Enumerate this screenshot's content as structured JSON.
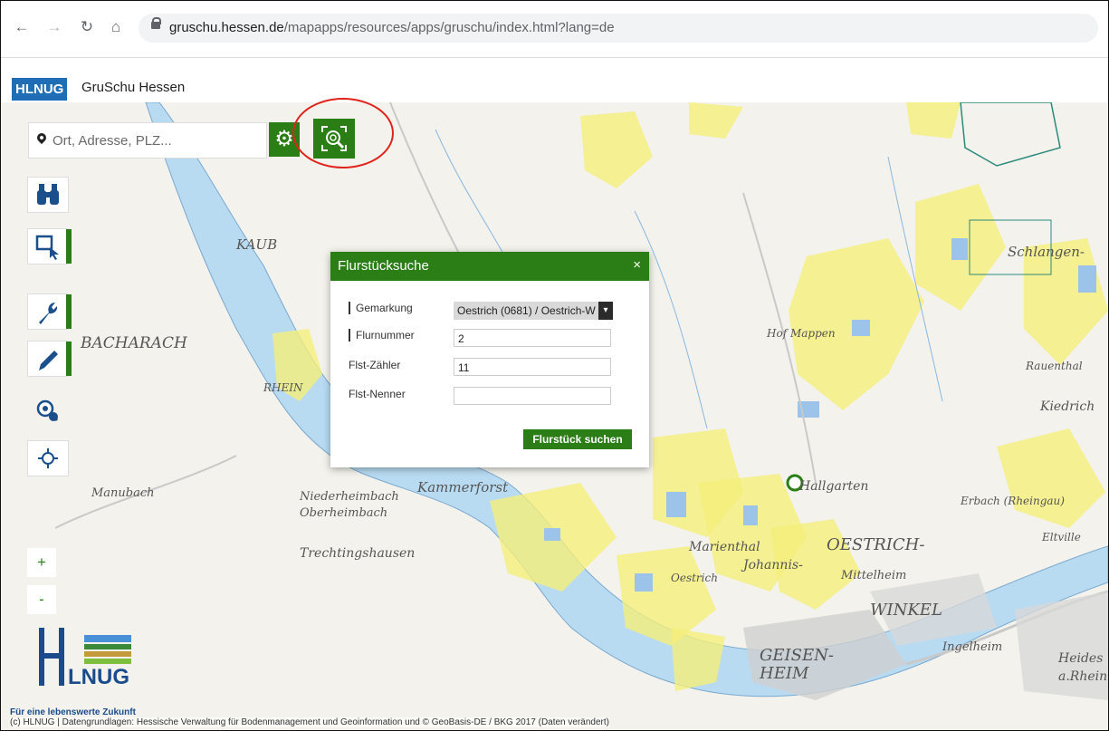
{
  "browser": {
    "url_host": "gruschu.hessen.de",
    "url_path": "/mapapps/resources/apps/gruschu/index.html?lang=de"
  },
  "header": {
    "brand": "HLNUG",
    "title": "GruSchu Hessen"
  },
  "search": {
    "placeholder": "Ort, Adresse, PLZ..."
  },
  "map": {
    "labels": [
      {
        "text": "BACHARACH",
        "size": 17
      },
      {
        "text": "KAUB",
        "size": 15
      },
      {
        "text": "Kammerforst",
        "size": 15
      },
      {
        "text": "Hallgarten",
        "size": 14
      },
      {
        "text": "OESTRICH-",
        "size": 18
      },
      {
        "text": "WINKEL",
        "size": 18
      },
      {
        "text": "GEISEN-",
        "size": 18
      },
      {
        "text": "HEIM",
        "size": 18
      },
      {
        "text": "Schlangen-",
        "size": 15
      },
      {
        "text": "Kiedrich",
        "size": 14
      },
      {
        "text": "Hof Mappen",
        "size": 12
      },
      {
        "text": "Rauenthal",
        "size": 12
      },
      {
        "text": "Trechtingshausen",
        "size": 14
      },
      {
        "text": "Oestrich",
        "size": 12
      },
      {
        "text": "Marienthal",
        "size": 14
      },
      {
        "text": "Johannis-",
        "size": 14
      },
      {
        "text": "Mittelheim",
        "size": 13
      },
      {
        "text": "Heides",
        "size": 14
      },
      {
        "text": "a.Rhein",
        "size": 14
      },
      {
        "text": "RHEIN",
        "size": 12
      },
      {
        "text": "Erbach (Rheingau)",
        "size": 12
      },
      {
        "text": "Manubach",
        "size": 13
      },
      {
        "text": "Oberheimbach",
        "size": 13
      },
      {
        "text": "Niederheimbach",
        "size": 13
      },
      {
        "text": "Ingelheim",
        "size": 13
      },
      {
        "text": "Eltville",
        "size": 12
      }
    ]
  },
  "dialog": {
    "title": "Flurstücksuche",
    "close": "×",
    "fields": {
      "gemarkung_label": "Gemarkung",
      "gemarkung_value": "Oestrich (0681) / Oestrich-W",
      "flurnummer_label": "Flurnummer",
      "flurnummer_value": "2",
      "zaehler_label": "Flst-Zähler",
      "zaehler_value": "11",
      "nenner_label": "Flst-Nenner",
      "nenner_value": ""
    },
    "submit_label": "Flurstück suchen"
  },
  "zoom": {
    "in": "+",
    "out": "-"
  },
  "logo": {
    "text": "HLNUG",
    "slogan": "Für eine lebenswerte Zukunft"
  },
  "credits": "(c) HLNUG | Datengrundlagen: Hessische Verwaltung für Bodenmanagement und Geoinformation und © GeoBasis-DE / BKG 2017 (Daten verändert)",
  "colors": {
    "accent": "#2b7d16",
    "brand_blue": "#1f6db4",
    "highlight": "#e0231b"
  }
}
